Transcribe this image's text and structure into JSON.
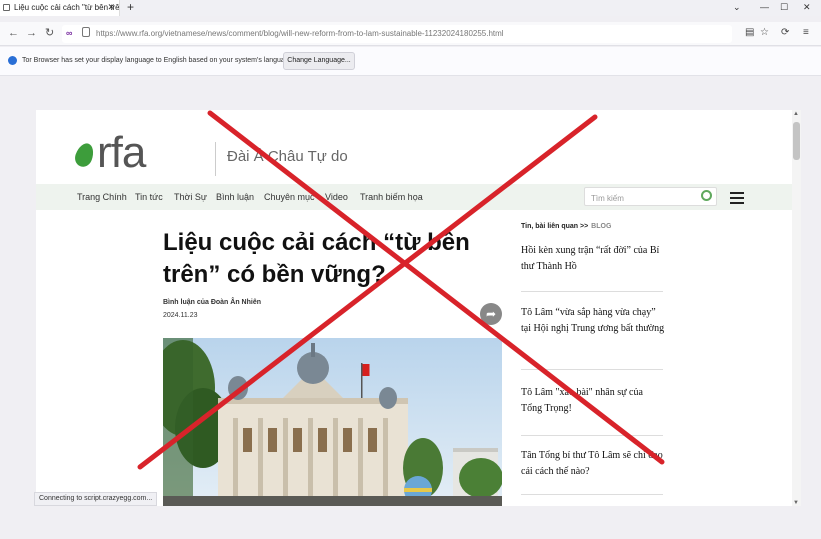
{
  "browser": {
    "tab_title": "Liệu cuộc cải cách \"từ bên trên\"",
    "tab_close": "✕",
    "new_tab": "+",
    "url": "https://www.rfa.org/vietnamese/news/comment/blog/will-new-reform-from-to-lam-sustainable-11232024180255.html",
    "notification_text": "Tor Browser has set your display language to English based on your system's language.",
    "notification_button": "Change Language..."
  },
  "site": {
    "logo": "rfa",
    "tagline": "Đài Á Châu Tự do",
    "menu": [
      "Trang Chính",
      "Tin tức",
      "Thời Sự",
      "Bình luận",
      "Chuyên mục",
      "Video",
      "Tranh biếm họa"
    ],
    "search_placeholder": "Tìm kiếm"
  },
  "article": {
    "headline": "Liệu cuộc cải cách “từ bên trên” có bền vững?",
    "byline": "Bình luận của Đoàn Ân Nhiên",
    "date": "2024.11.23"
  },
  "sidebar": {
    "heading": "Tin, bài liên quan >>",
    "heading_tag": "BLOG",
    "items": [
      "Hồi kèn xung trận “rất đời” của Bí thư Thành Hồ",
      "Tô Lâm “vừa sắp hàng vừa chạy” tại Hội nghị Trung ương bất thường",
      "Tô Lâm \"xào bài\" nhân sự của Tổng Trọng!",
      "Tân Tổng bí thư Tô Lâm sẽ chỉ đạo cải cách thế nào?"
    ]
  },
  "status": "Connecting to script.crazyegg.com...",
  "colors": {
    "brand_green": "#3d9d3b",
    "overlay_x": "#d8232a"
  }
}
